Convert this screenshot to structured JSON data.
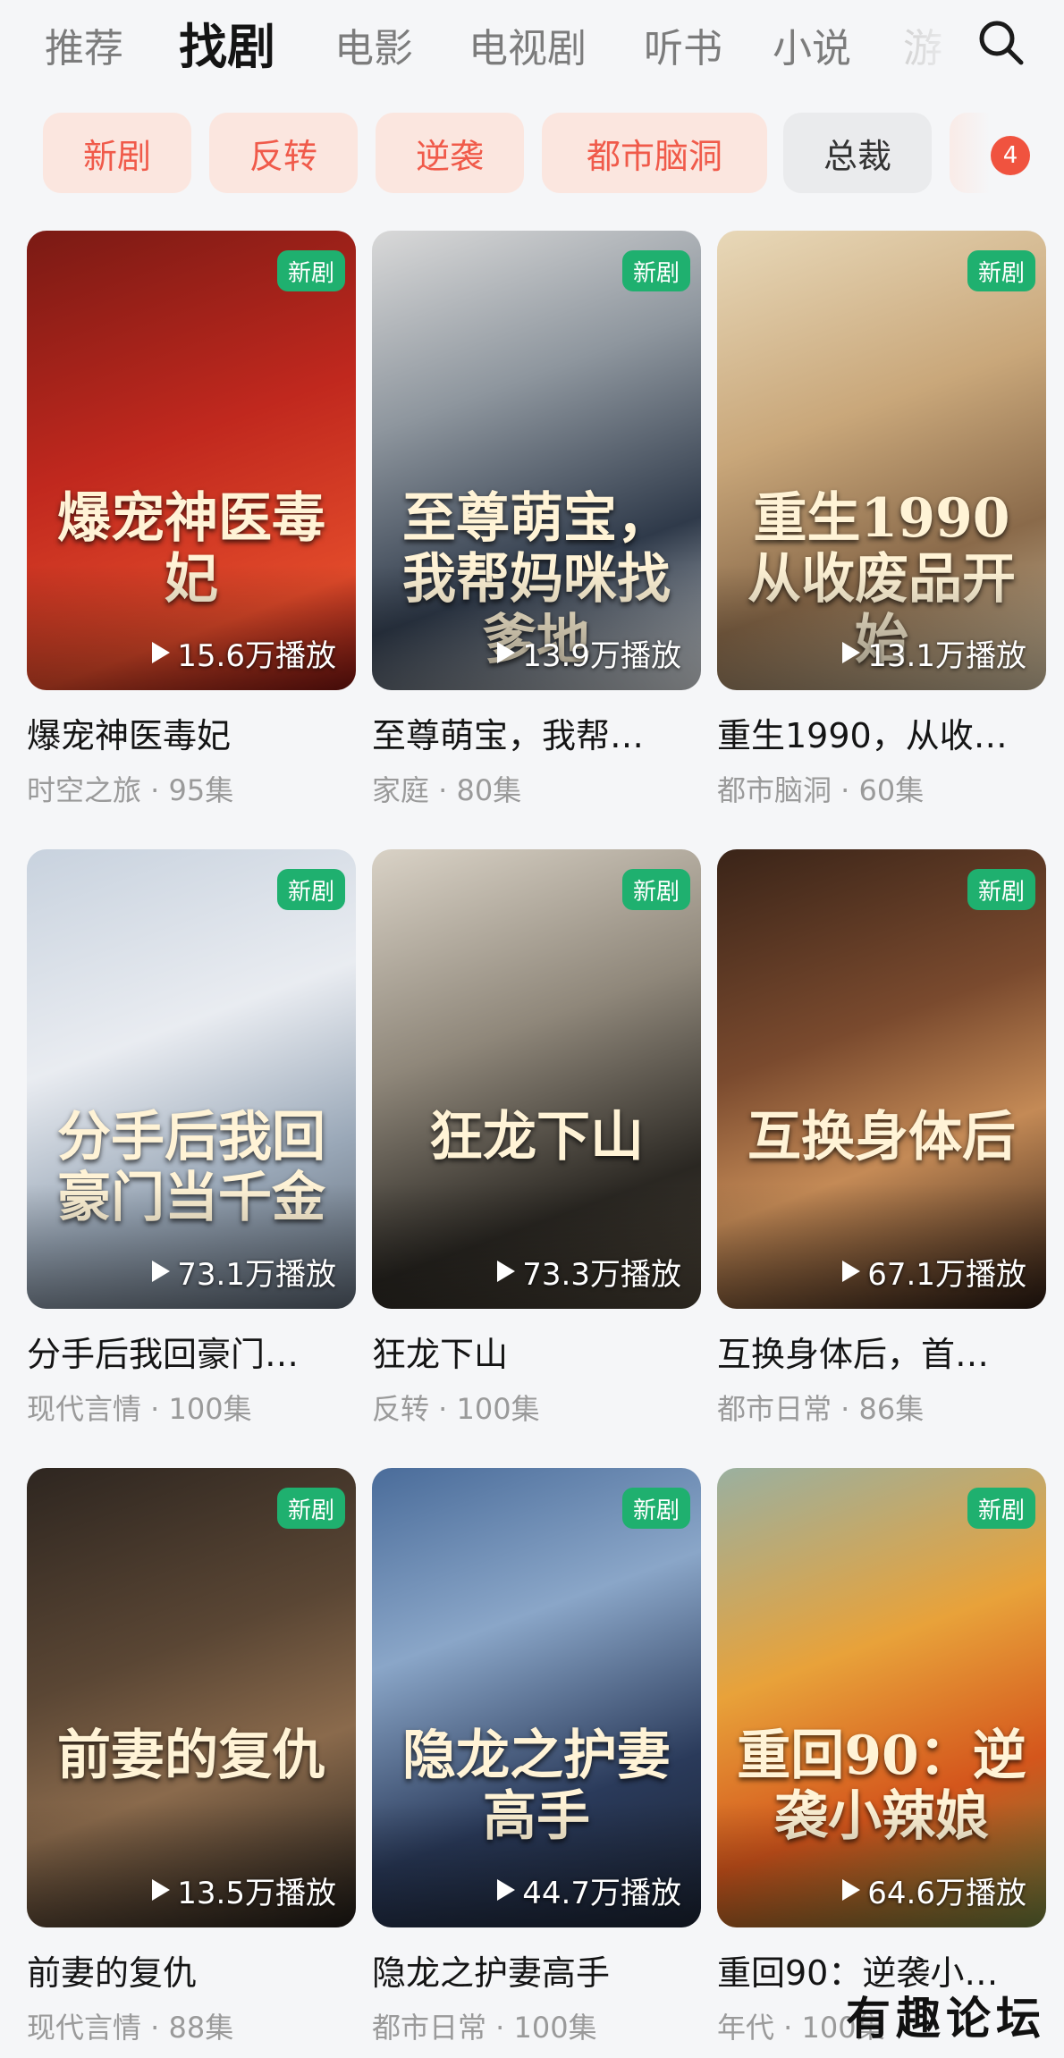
{
  "top_tabs": [
    {
      "label": "推荐"
    },
    {
      "label": "找剧"
    },
    {
      "label": "电影"
    },
    {
      "label": "电视剧"
    },
    {
      "label": "听书"
    },
    {
      "label": "小说"
    },
    {
      "label": "游"
    }
  ],
  "active_tab": "找剧",
  "chips": [
    {
      "label": "新剧"
    },
    {
      "label": "反转"
    },
    {
      "label": "逆袭"
    },
    {
      "label": "都市脑洞"
    },
    {
      "label": "总裁"
    }
  ],
  "chip_badge": "4",
  "colors": {
    "accent_red": "#f05a4a",
    "chip_bg": "#fbe6df",
    "new_badge": "#1fb06f"
  },
  "cards": [
    {
      "poster_title": "爆宠神医毒妃",
      "badge": "新剧",
      "plays": "15.6万播放",
      "title": "爆宠神医毒妃",
      "meta": "时空之旅 · 95集"
    },
    {
      "poster_title": "至尊萌宝，我帮妈咪找爹地",
      "badge": "新剧",
      "plays": "13.9万播放",
      "title": "至尊萌宝，我帮…",
      "meta": "家庭 · 80集"
    },
    {
      "poster_title": "重生1990 从收废品开始",
      "badge": "新剧",
      "plays": "13.1万播放",
      "title": "重生1990，从收…",
      "meta": "都市脑洞 · 60集"
    },
    {
      "poster_title": "分手后我回豪门当千金",
      "badge": "新剧",
      "plays": "73.1万播放",
      "title": "分手后我回豪门…",
      "meta": "现代言情 · 100集"
    },
    {
      "poster_title": "狂龙下山",
      "badge": "新剧",
      "plays": "73.3万播放",
      "title": "狂龙下山",
      "meta": "反转 · 100集"
    },
    {
      "poster_title": "互换身体后",
      "badge": "新剧",
      "plays": "67.1万播放",
      "title": "互换身体后，首…",
      "meta": "都市日常 · 86集"
    },
    {
      "poster_title": "前妻的复仇",
      "badge": "新剧",
      "plays": "13.5万播放",
      "title": "前妻的复仇",
      "meta": "现代言情 · 88集"
    },
    {
      "poster_title": "隐龙之护妻高手",
      "badge": "新剧",
      "plays": "44.7万播放",
      "title": "隐龙之护妻高手",
      "meta": "都市日常 · 100集"
    },
    {
      "poster_title": "重回90：逆袭小辣娘",
      "badge": "新剧",
      "plays": "64.6万播放",
      "title": "重回90：逆袭小…",
      "meta": "年代 · 100集"
    }
  ],
  "watermark": "有趣论坛"
}
